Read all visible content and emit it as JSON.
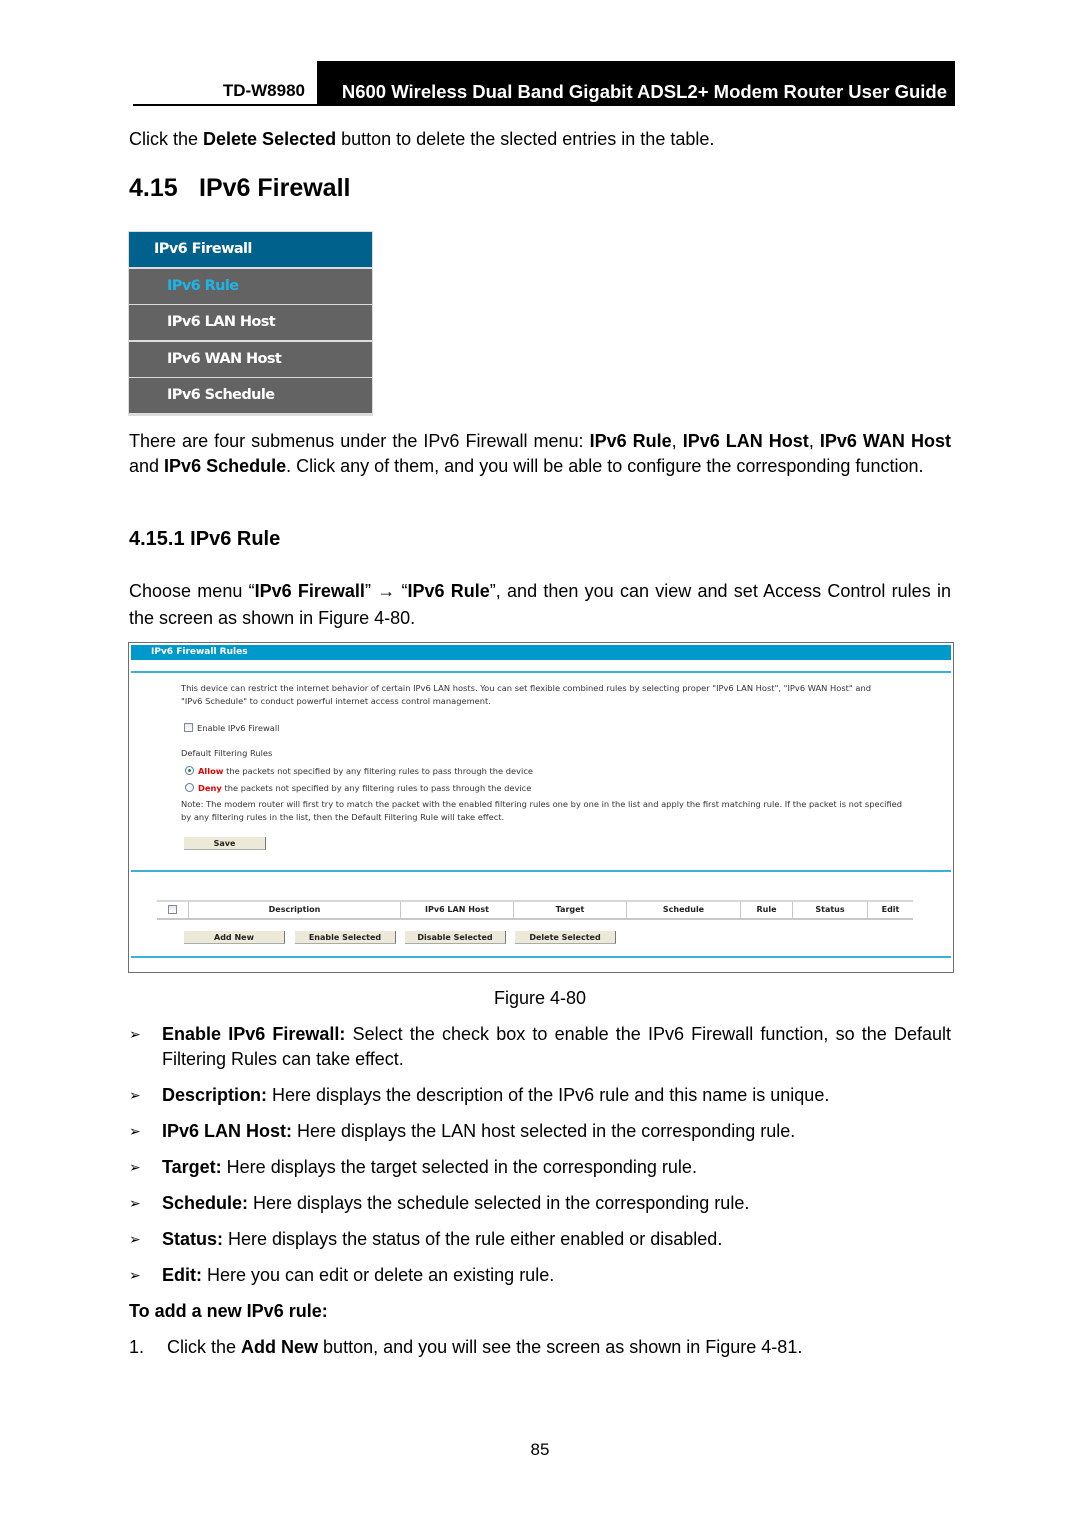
{
  "header": {
    "model": "TD-W8980",
    "guide_title": "N600 Wireless Dual Band Gigabit ADSL2+ Modem Router User Guide"
  },
  "intro": {
    "prefix": "Click the ",
    "bold": "Delete Selected",
    "suffix": " button to delete the slected entries in the table."
  },
  "section": {
    "number": "4.15",
    "title": "IPv6 Firewall"
  },
  "menu": {
    "title": "IPv6 Firewall",
    "items": [
      {
        "label": "IPv6 Rule",
        "active": true
      },
      {
        "label": "IPv6 LAN Host",
        "active": false
      },
      {
        "label": "IPv6 WAN Host",
        "active": false
      },
      {
        "label": "IPv6 Schedule",
        "active": false
      }
    ]
  },
  "submenu_para": {
    "t1": "There are four submenus under the IPv6 Firewall menu: ",
    "b1": "IPv6 Rule",
    "t2": ", ",
    "b2": "IPv6 LAN Host",
    "t3": ", ",
    "b3": "IPv6 WAN Host",
    "t4": " and ",
    "b4": "IPv6 Schedule",
    "t5": ". Click any of them, and you will be able to configure the corresponding function."
  },
  "subsection": {
    "number": "4.15.1",
    "title": "IPv6 Rule"
  },
  "choose_para": {
    "t1": "Choose menu “",
    "b1": "IPv6 Firewall",
    "t2": "” → “",
    "b2": "IPv6 Rule",
    "t3": "”, and then you can view and set Access Control rules in the screen as shown in Figure 4-80."
  },
  "figure": {
    "panel_title": "IPv6 Firewall Rules",
    "desc_line1": "This device can restrict the internet behavior of certain IPv6 LAN hosts. You can set flexible combined rules by selecting proper \"IPv6 LAN Host\", \"IPv6 WAN Host\" and",
    "desc_line2": "\"IPv6 Schedule\" to conduct powerful internet access control management.",
    "enable_label": "Enable IPv6 Firewall",
    "enable_checked": false,
    "default_rules_label": "Default Filtering Rules",
    "allow_word": "Allow",
    "allow_text": " the packets not specified by any filtering rules to pass through the device",
    "deny_word": "Deny",
    "deny_text": " the packets not specified by any filtering rules to pass through the device",
    "selected_rule": "Allow",
    "note_line1": "Note: The modem router will first try to match the packet with the enabled filtering rules one by one in the list and apply the first matching rule. If the packet is not specified",
    "note_line2": "by any filtering rules in the list, then the Default Filtering Rule will take effect.",
    "save_label": "Save",
    "table_columns": [
      "Description",
      "IPv6 LAN Host",
      "Target",
      "Schedule",
      "Rule",
      "Status",
      "Edit"
    ],
    "buttons": {
      "add_new": "Add New",
      "enable_selected": "Enable Selected",
      "disable_selected": "Disable Selected",
      "delete_selected": "Delete Selected"
    },
    "caption": "Figure 4-80"
  },
  "bullets": [
    {
      "term": "Enable IPv6 Firewall:",
      "text": " Select the check box to enable the IPv6 Firewall function, so the Default Filtering Rules can take effect."
    },
    {
      "term": "Description:",
      "text": " Here displays the description of the IPv6 rule and this name is unique."
    },
    {
      "term": "IPv6 LAN Host:",
      "text": " Here displays the LAN host selected in the corresponding rule."
    },
    {
      "term": "Target:",
      "text": " Here displays the target selected in the corresponding rule."
    },
    {
      "term": "Schedule:",
      "text": " Here displays the schedule selected in the corresponding rule."
    },
    {
      "term": "Status:",
      "text": " Here displays the status of the rule either enabled or disabled."
    },
    {
      "term": "Edit:",
      "text": " Here you can edit or delete an existing rule."
    }
  ],
  "bullet_glyph": "➢",
  "add_rule_heading": "To add a new IPv6 rule:",
  "step1": {
    "num": "1.",
    "t1": "Click the ",
    "b1": "Add New",
    "t2": " button, and you will see the screen as shown in Figure 4-81."
  },
  "page_number": "85"
}
